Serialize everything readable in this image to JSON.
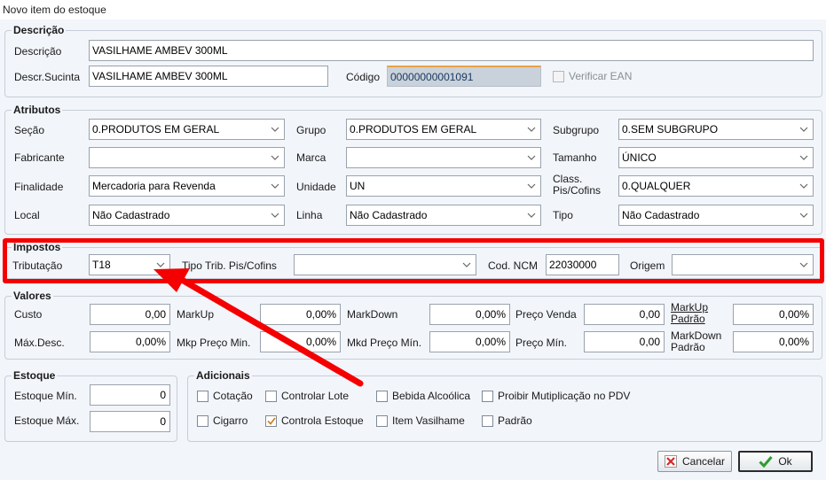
{
  "window": {
    "title": "Novo item do estoque"
  },
  "descricao": {
    "title": "Descrição",
    "descricao_label": "Descrição",
    "descricao_value": "VASILHAME AMBEV 300ML",
    "sucinta_label": "Descr.Sucinta",
    "sucinta_value": "VASILHAME AMBEV 300ML",
    "codigo_label": "Código",
    "codigo_value": "00000000001091",
    "verificar_ean_label": "Verificar EAN"
  },
  "atributos": {
    "title": "Atributos",
    "secao_label": "Seção",
    "secao_value": "0.PRODUTOS EM GERAL",
    "grupo_label": "Grupo",
    "grupo_value": "0.PRODUTOS EM GERAL",
    "subgrupo_label": "Subgrupo",
    "subgrupo_value": "0.SEM SUBGRUPO",
    "fabricante_label": "Fabricante",
    "fabricante_value": "",
    "marca_label": "Marca",
    "marca_value": "",
    "tamanho_label": "Tamanho",
    "tamanho_value": "ÚNICO",
    "finalidade_label": "Finalidade",
    "finalidade_value": "Mercadoria para Revenda",
    "unidade_label": "Unidade",
    "unidade_value": "UN",
    "class_label": "Class. Pis/Cofins",
    "class_value": "0.QUALQUER",
    "local_label": "Local",
    "local_value": "Não Cadastrado",
    "linha_label": "Linha",
    "linha_value": "Não Cadastrado",
    "tipo_label": "Tipo",
    "tipo_value": "Não Cadastrado"
  },
  "impostos": {
    "title": "Impostos",
    "tributacao_label": "Tributação",
    "tributacao_value": "T18",
    "tipo_trib_label": "Tipo Trib. Pis/Cofins",
    "tipo_trib_value": "",
    "ncm_label": "Cod. NCM",
    "ncm_value": "22030000",
    "origem_label": "Origem",
    "origem_value": ""
  },
  "valores": {
    "title": "Valores",
    "custo_label": "Custo",
    "custo_value": "0,00",
    "markup_label": "MarkUp",
    "markup_value": "0,00%",
    "markdown_label": "MarkDown",
    "markdown_value": "0,00%",
    "preco_venda_label": "Preço Venda",
    "preco_venda_value": "0,00",
    "markup_padrao_label": "MarkUp Padrão",
    "markup_padrao_value": "0,00%",
    "max_desc_label": "Máx.Desc.",
    "max_desc_value": "0,00%",
    "mkp_preco_min_label": "Mkp Preço Min.",
    "mkp_preco_min_value": "0,00%",
    "mkd_preco_min_label": "Mkd Preço Mín.",
    "mkd_preco_min_value": "0,00%",
    "preco_min_label": "Preço Mín.",
    "preco_min_value": "0,00",
    "markdown_padrao_label": "MarkDown Padrão",
    "markdown_padrao_value": "0,00%"
  },
  "estoque": {
    "title": "Estoque",
    "min_label": "Estoque Mín.",
    "min_value": "0",
    "max_label": "Estoque Máx.",
    "max_value": "0"
  },
  "adicionais": {
    "title": "Adicionais",
    "cotacao": "Cotação",
    "controlar_lote": "Controlar Lote",
    "bebida_alcoolica": "Bebida Alcoólica",
    "proibir_multiplicacao": "Proibir Mutiplicação no PDV",
    "cigarro": "Cigarro",
    "controla_estoque": "Controla Estoque",
    "item_vasilhame": "Item Vasilhame",
    "padrao": "Padrão"
  },
  "buttons": {
    "cancelar": "Cancelar",
    "ok": "Ok"
  },
  "colors": {
    "highlight": "#f40000",
    "arrow": "#f40000",
    "ok_icon": "#2e9d2e",
    "cancel_icon": "#d22b2b"
  }
}
